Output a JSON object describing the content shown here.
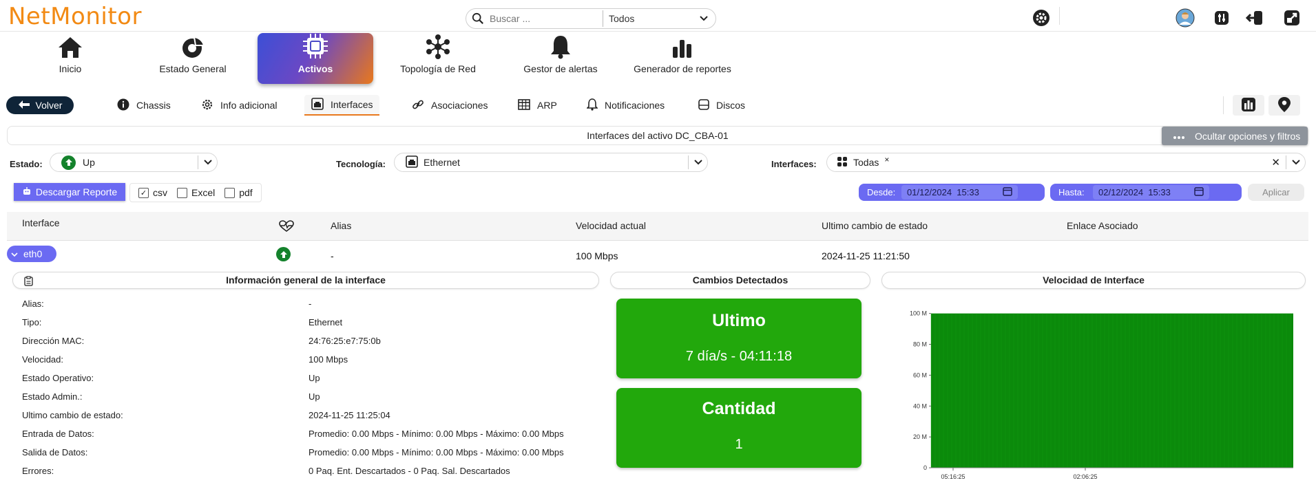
{
  "app": {
    "logo": "NetMonitor",
    "search_placeholder": "Buscar ...",
    "search_scope": "Todos"
  },
  "mainnav": [
    {
      "label": "Inicio",
      "icon": "home-icon"
    },
    {
      "label": "Estado General",
      "icon": "pie-chart-icon"
    },
    {
      "label": "Activos",
      "icon": "chip-icon"
    },
    {
      "label": "Topología de Red",
      "icon": "network-icon"
    },
    {
      "label": "Gestor de alertas",
      "icon": "bell-icon"
    },
    {
      "label": "Generador de reportes",
      "icon": "bar-chart-icon"
    }
  ],
  "subnav": {
    "back": "Volver",
    "items": [
      {
        "label": "Chassis",
        "icon": "info-icon"
      },
      {
        "label": "Info adicional",
        "icon": "gear-icon"
      },
      {
        "label": "Interfaces",
        "icon": "ethernet-icon"
      },
      {
        "label": "Asociaciones",
        "icon": "link-icon"
      },
      {
        "label": "ARP",
        "icon": "table-icon"
      },
      {
        "label": "Notificaciones",
        "icon": "bell-icon"
      },
      {
        "label": "Discos",
        "icon": "disk-icon"
      }
    ]
  },
  "title": "Interfaces del activo DC_CBA-01",
  "hide_filters": "Ocultar opciones y filtros",
  "filters": {
    "estado_label": "Estado:",
    "estado_value": "Up",
    "tecnologia_label": "Tecnología:",
    "tecnologia_value": "Ethernet",
    "interfaces_label": "Interfaces:",
    "interfaces_value": "Todas",
    "chip_close": "×",
    "clear": "✕"
  },
  "report": {
    "download": "Descargar Reporte",
    "csv": "csv",
    "excel": "Excel",
    "pdf": "pdf",
    "csv_checked": true,
    "desde_label": "Desde:",
    "desde_value": "01/12/2024  15:33",
    "hasta_label": "Hasta:",
    "hasta_value": "02/12/2024  15:33",
    "apply": "Aplicar"
  },
  "table": {
    "headers": {
      "interface": "Interface",
      "alias": "Alias",
      "speed": "Velocidad actual",
      "last_change": "Ultimo cambio de estado",
      "link": "Enlace Asociado"
    },
    "row": {
      "name": "eth0",
      "alias": "-",
      "speed": "100 Mbps",
      "last_change": "2024-11-25 11:21:50"
    }
  },
  "info_panel": {
    "title": "Información general de la interface",
    "rows": [
      {
        "label": "Alias:",
        "value": "-"
      },
      {
        "label": "Tipo:",
        "value": "Ethernet"
      },
      {
        "label": "Dirección MAC:",
        "value": "24:76:25:e7:75:0b"
      },
      {
        "label": "Velocidad:",
        "value": "100 Mbps"
      },
      {
        "label": "Estado Operativo:",
        "value": "Up"
      },
      {
        "label": "Estado Admin.:",
        "value": "Up"
      },
      {
        "label": "Ultimo cambio de estado:",
        "value": "2024-11-25 11:25:04"
      },
      {
        "label": "Entrada de Datos:",
        "value": "Promedio: 0.00 Mbps - Mínimo: 0.00 Mbps - Máximo: 0.00 Mbps"
      },
      {
        "label": "Salida de Datos:",
        "value": "Promedio: 0.00 Mbps - Mínimo: 0.00 Mbps - Máximo: 0.00 Mbps"
      },
      {
        "label": "Errores:",
        "value": "0 Paq. Ent. Descartados - 0 Paq. Sal. Descartados"
      }
    ]
  },
  "changes_panel": {
    "title": "Cambios Detectados",
    "last_title": "Ultimo",
    "last_value": "7 día/s - 04:11:18",
    "count_title": "Cantidad",
    "count_value": "1"
  },
  "speed_panel": {
    "title": "Velocidad de Interface"
  },
  "chart_data": {
    "type": "area",
    "title": "",
    "xlabel": "",
    "ylabel": "",
    "y_ticks": [
      "0",
      "20 M",
      "40 M",
      "60 M",
      "80 M",
      "100 M"
    ],
    "x_ticks": [
      "05:16:25",
      "02:06:25"
    ],
    "ylim": [
      0,
      115
    ],
    "series": [
      {
        "values": [
          100,
          100,
          100,
          100,
          100,
          100,
          100,
          100,
          100,
          100
        ]
      }
    ],
    "fill_color": "#0b8a0b"
  },
  "colors": {
    "accent": "#6b6af2",
    "brand": "#f28a14",
    "success": "#22a80c"
  }
}
